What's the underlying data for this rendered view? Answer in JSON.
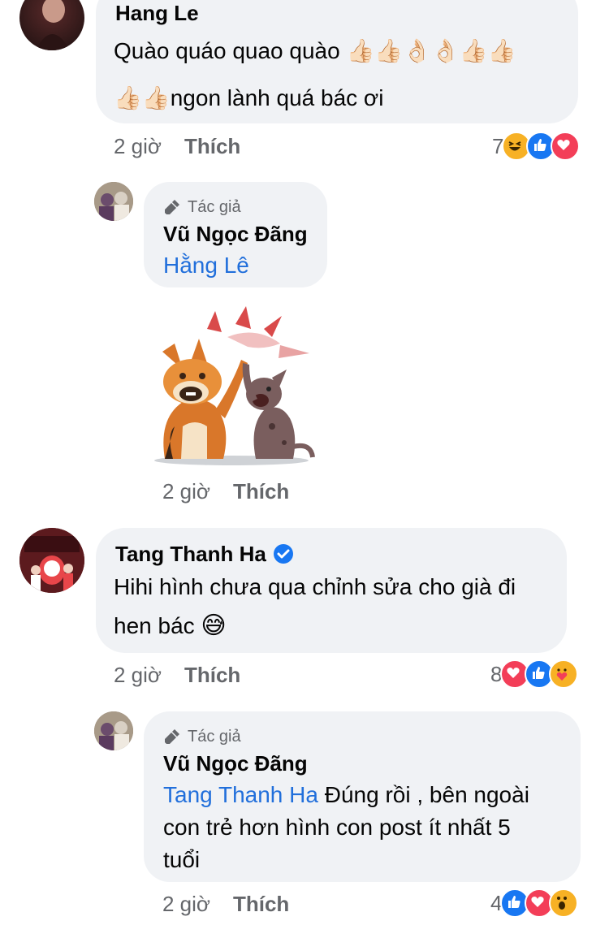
{
  "comments": [
    {
      "name": "Hang Le",
      "text_line1": "Quào quáo quao quào 👍🏻👍🏻👌🏻👌🏻👍🏻👍🏻",
      "text_line2": "👍🏻👍🏻ngon lành quá bác ơi",
      "time": "2 giờ",
      "like_label": "Thích",
      "reaction_count": "7",
      "reactions": [
        "haha-icon",
        "like-icon",
        "love-icon"
      ]
    },
    {
      "author_badge": "Tác giả",
      "name": "Vũ Ngọc Đãng",
      "mention": "Hằng Lê",
      "sticker": "corgi-high-five-sticker",
      "time": "2 giờ",
      "like_label": "Thích"
    },
    {
      "name": "Tang Thanh Ha",
      "verified": true,
      "text_line1": "Hihi hình chưa qua chỉnh sửa cho già đi",
      "text_line2": "hen bác",
      "text_line2_emoji": "😅",
      "time": "2 giờ",
      "like_label": "Thích",
      "reaction_count": "8",
      "reactions": [
        "love-icon",
        "like-icon",
        "care-icon"
      ]
    },
    {
      "author_badge": "Tác giả",
      "name": "Vũ Ngọc Đãng",
      "mention": "Tang Thanh Ha",
      "text_after_mention": " Đúng rồi , bên ngoài",
      "text_line2": "con trẻ hơn hình con post ít nhất 5",
      "text_line3": "tuổi",
      "time": "2 giờ",
      "like_label": "Thích",
      "reaction_count": "4",
      "reactions": [
        "like-icon",
        "love-icon",
        "wow-icon"
      ]
    }
  ],
  "colors": {
    "bubble": "#f0f2f5",
    "link": "#216fdb",
    "like": "#1877f2",
    "love": "#f33e58",
    "haha": "#f7b125",
    "meta": "#65676b"
  }
}
